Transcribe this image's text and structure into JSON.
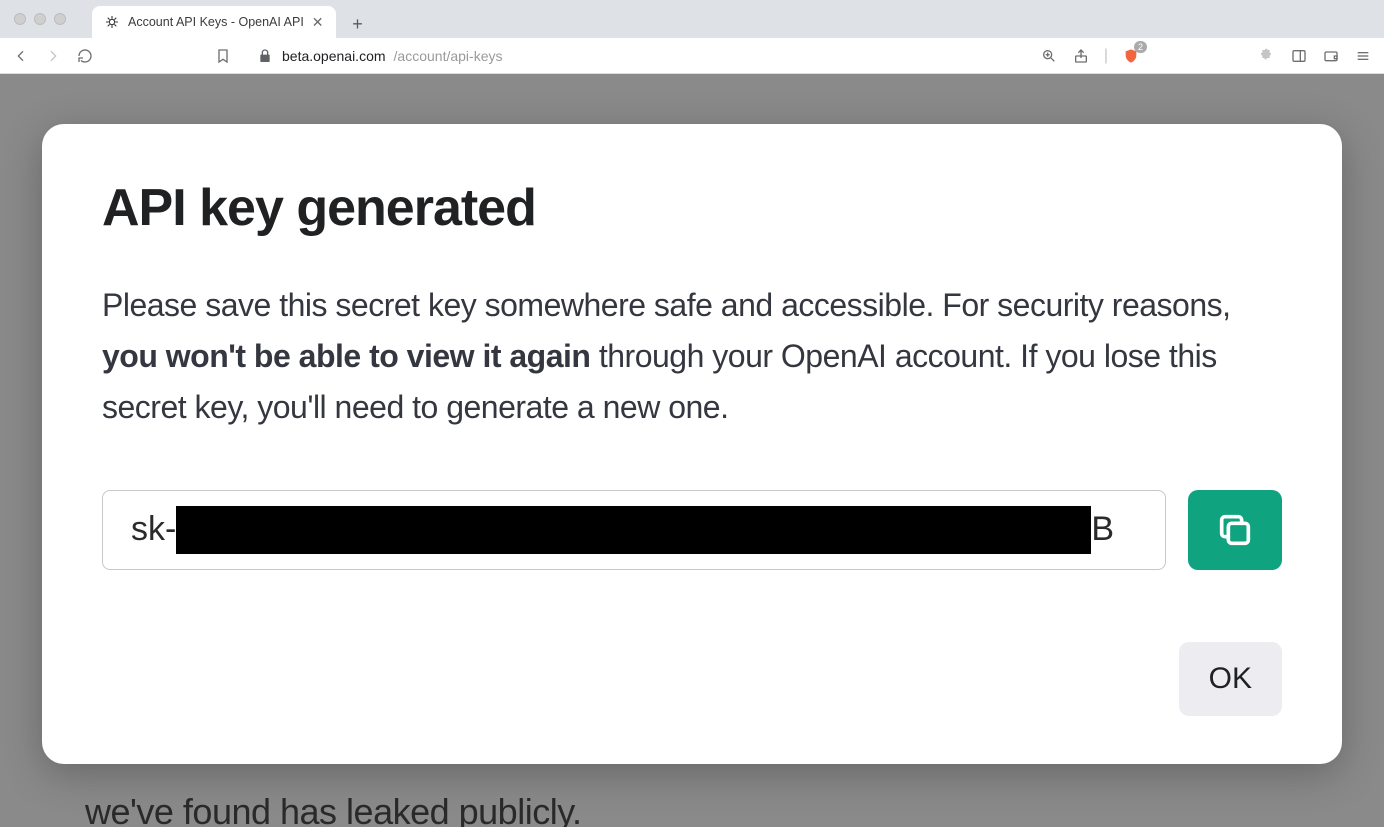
{
  "browser": {
    "tab_title": "Account API Keys - OpenAI API",
    "url_host": "beta.openai.com",
    "url_path": "/account/api-keys",
    "shield_count": "2"
  },
  "background": {
    "leaked_text": "we've found has leaked publicly."
  },
  "modal": {
    "title": "API key generated",
    "desc_before": "Please save this secret key somewhere safe and accessible. For security reasons, ",
    "desc_bold": "you won't be able to view it again",
    "desc_after": " through your OpenAI account. If you lose this secret key, you'll need to generate a new one.",
    "key_prefix": "sk-",
    "key_suffix": "B",
    "ok_label": "OK"
  }
}
